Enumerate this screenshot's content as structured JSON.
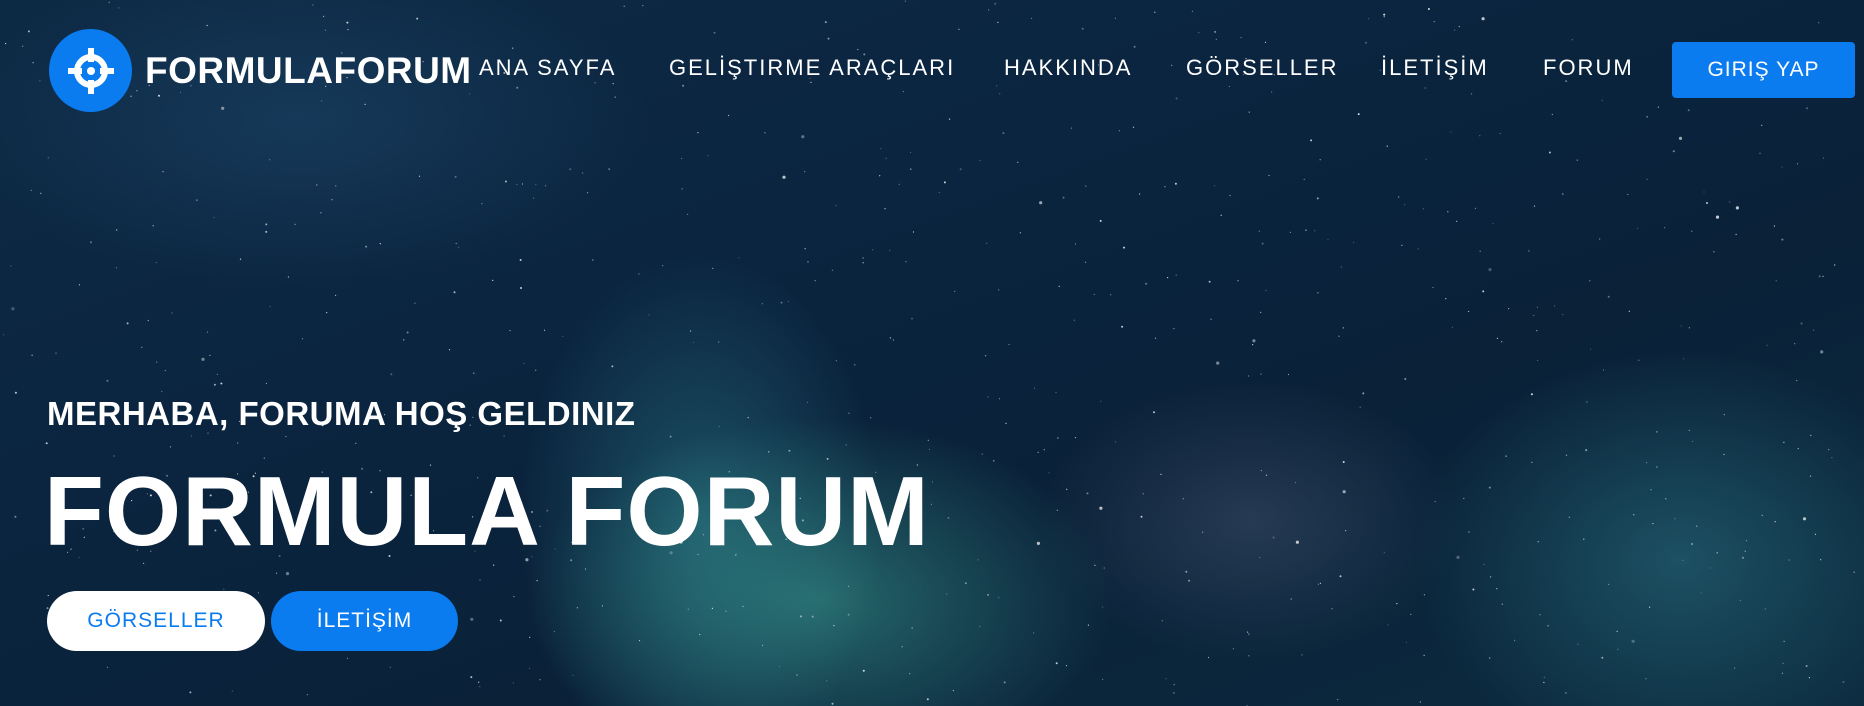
{
  "colors": {
    "accent": "#0a7cf0",
    "background": "#0b2540",
    "text": "#ffffff"
  },
  "brand": {
    "name": "FORMULAFORUM",
    "icon": "crosshair-icon"
  },
  "nav": {
    "items": [
      {
        "label": "ANA SAYFA"
      },
      {
        "label": "GELİŞTIRME ARAÇLARI"
      },
      {
        "label": "HAKKINDA"
      },
      {
        "label": "GÖRSELLER"
      },
      {
        "label": "İLETİŞİM"
      },
      {
        "label": "FORUM"
      }
    ],
    "login_label": "GIRIŞ YAP"
  },
  "hero": {
    "welcome": "MERHABA, FORUMA HOŞ GELDINIZ",
    "title": "FORMULA FORUM",
    "primary_button": "GÖRSELLER",
    "secondary_button": "İLETİŞİM"
  }
}
